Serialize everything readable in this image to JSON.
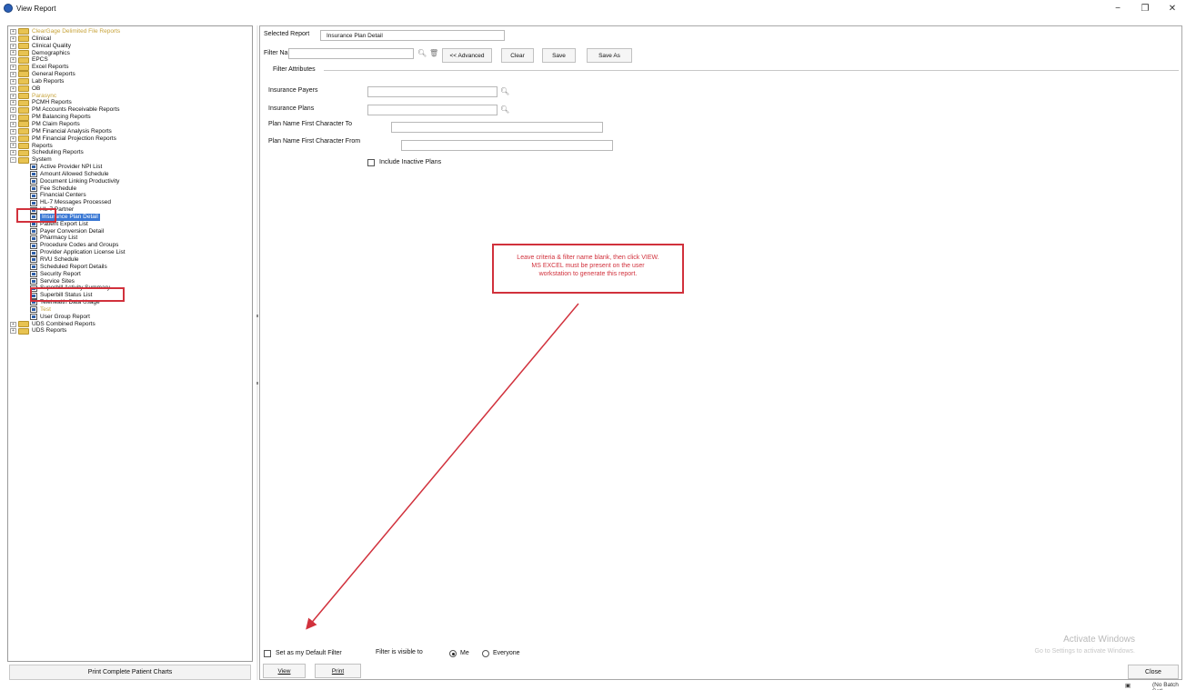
{
  "window": {
    "title": "View Report",
    "controls": {
      "minimize": "−",
      "restore": "❐",
      "close": "✕"
    }
  },
  "tree": {
    "items": [
      {
        "label": "ClearGage Delimited File Reports",
        "type": "folder",
        "expanded": false,
        "gold": true
      },
      {
        "label": "Clinical",
        "type": "folder"
      },
      {
        "label": "Clinical Quality",
        "type": "folder"
      },
      {
        "label": "Demographics",
        "type": "folder"
      },
      {
        "label": "EPCS",
        "type": "folder"
      },
      {
        "label": "Excel Reports",
        "type": "folder"
      },
      {
        "label": "General Reports",
        "type": "folder"
      },
      {
        "label": "Lab Reports",
        "type": "folder"
      },
      {
        "label": "OB",
        "type": "folder"
      },
      {
        "label": "Parasync",
        "type": "folder",
        "gold": true
      },
      {
        "label": "PCMH Reports",
        "type": "folder"
      },
      {
        "label": "PM Accounts Receivable Reports",
        "type": "folder"
      },
      {
        "label": "PM Balancing Reports",
        "type": "folder"
      },
      {
        "label": "PM Claim Reports",
        "type": "folder"
      },
      {
        "label": "PM Financial Analysis Reports",
        "type": "folder"
      },
      {
        "label": "PM Financial Projection Reports",
        "type": "folder"
      },
      {
        "label": "Reports",
        "type": "folder"
      },
      {
        "label": "Scheduling Reports",
        "type": "folder"
      },
      {
        "label": "System",
        "type": "folder",
        "expanded": true
      },
      {
        "label": "Active Provider NPI List",
        "type": "report"
      },
      {
        "label": "Amount Allowed Schedule",
        "type": "report"
      },
      {
        "label": "Document Linking Productivity",
        "type": "report"
      },
      {
        "label": "Fee Schedule",
        "type": "report"
      },
      {
        "label": "Financial Centers",
        "type": "report"
      },
      {
        "label": "HL-7 Messages Processed",
        "type": "report"
      },
      {
        "label": "HL-7 Partner",
        "type": "report"
      },
      {
        "label": "Insurance Plan Detail",
        "type": "report",
        "selected": true
      },
      {
        "label": "Patient Export List",
        "type": "report"
      },
      {
        "label": "Payer Conversion Detail",
        "type": "report"
      },
      {
        "label": "Pharmacy List",
        "type": "report"
      },
      {
        "label": "Procedure Codes and Groups",
        "type": "report"
      },
      {
        "label": "Provider Application License List",
        "type": "report"
      },
      {
        "label": "RVU Schedule",
        "type": "report"
      },
      {
        "label": "Scheduled Report Details",
        "type": "report"
      },
      {
        "label": "Security Report",
        "type": "report"
      },
      {
        "label": "Service Sites",
        "type": "report"
      },
      {
        "label": "Superbill Activity Summary",
        "type": "report"
      },
      {
        "label": "Superbill Status List",
        "type": "report"
      },
      {
        "label": "Telehealth Data Usage",
        "type": "report"
      },
      {
        "label": "Test",
        "type": "report",
        "gold": true
      },
      {
        "label": "User Group Report",
        "type": "report"
      },
      {
        "label": "UDS Combined Reports",
        "type": "folder"
      },
      {
        "label": "UDS Reports",
        "type": "folder"
      }
    ],
    "print_button": "Print Complete Patient Charts"
  },
  "form": {
    "selected_report_label": "Selected Report",
    "selected_report_value": "Insurance Plan Detail",
    "filter_name_label": "Filter Name",
    "filter_name_value": "",
    "advanced_button": "<< Advanced",
    "clear_button": "Clear",
    "save_button": "Save",
    "save_as_button": "Save As",
    "filter_attributes_label": "Filter Attributes",
    "insurance_payers_label": "Insurance Payers",
    "insurance_plans_label": "Insurance Plans",
    "plan_first_to_label": "Plan Name First Character To",
    "plan_first_from_label": "Plan Name First Character From",
    "include_inactive_label": "Include Inactive Plans",
    "include_inactive_checked": false
  },
  "callout": {
    "line1": "Leave criteria & filter name blank, then click VIEW.",
    "line2": "MS EXCEL must be present on the user",
    "line3": "workstation to generate this report.",
    "color": "#d1313c"
  },
  "footer": {
    "default_filter_label": "Set as my Default Filter",
    "default_filter_checked": false,
    "visible_to_label": "Filter is visible to",
    "visible_me": "Me",
    "visible_everyone": "Everyone",
    "visible_selected": "Me",
    "view_button": "View",
    "print_button": "Print",
    "close_button": "Close",
    "watermark_title": "Activate Windows",
    "watermark_sub": "Go to Settings to activate Windows.",
    "batch_status": "(No Batch Set)"
  }
}
